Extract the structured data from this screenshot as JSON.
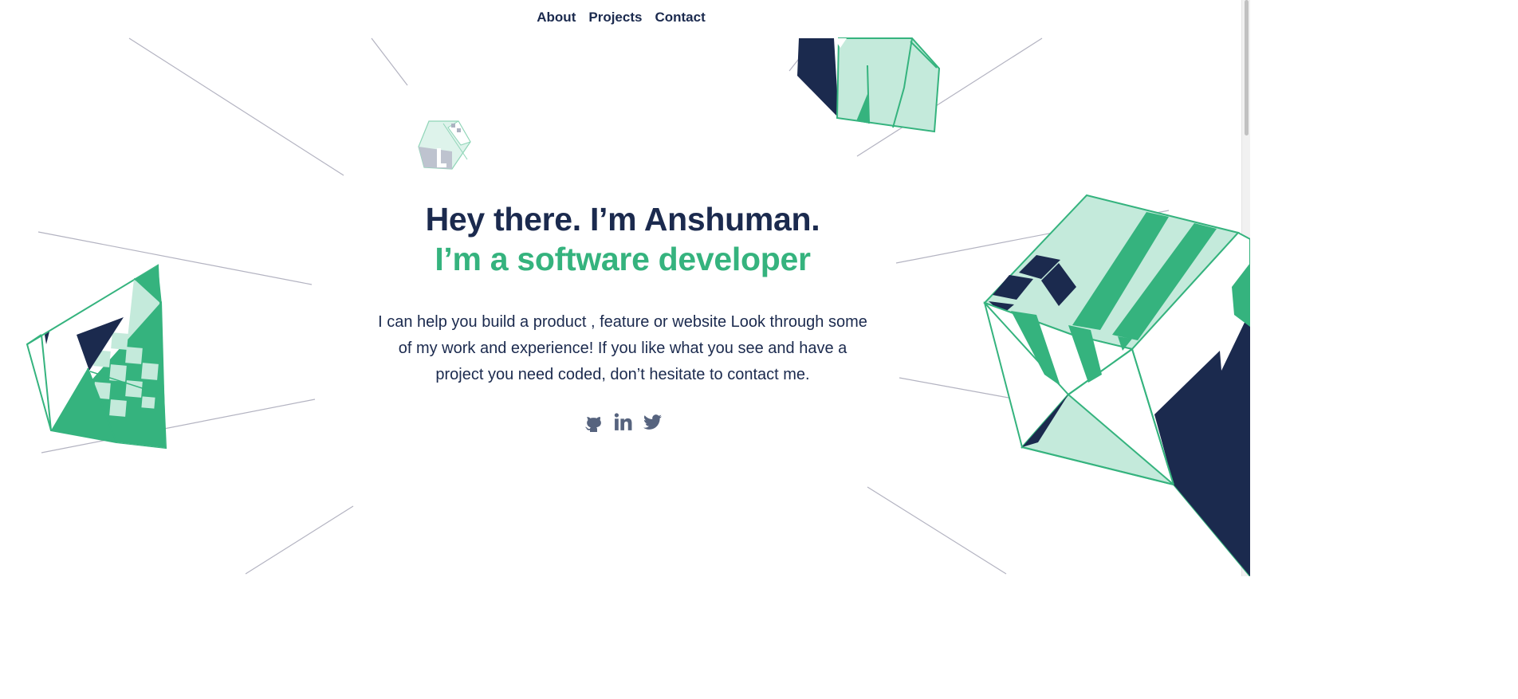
{
  "nav": {
    "items": [
      {
        "label": "About"
      },
      {
        "label": "Projects"
      },
      {
        "label": "Contact"
      }
    ]
  },
  "hero": {
    "headline": "Hey there. I’m Anshuman.",
    "subheadline": "I’m a software developer",
    "description": "I can help you build a product , feature or website Look through some of my work and experience! If you like what you see and have a project you need coded, don’t hesitate to contact me."
  },
  "social": [
    {
      "icon": "github-icon"
    },
    {
      "icon": "linkedin-icon"
    },
    {
      "icon": "twitter-icon"
    }
  ],
  "colors": {
    "navy": "#1b2a4e",
    "green": "#35b37e",
    "mint": "#c4eadb",
    "line": "#b3b3c1"
  }
}
